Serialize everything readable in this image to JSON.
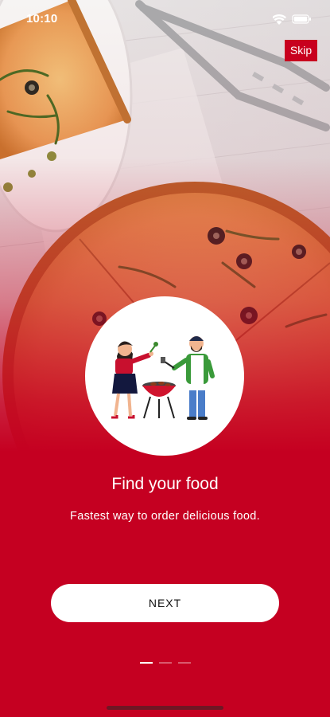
{
  "status_bar": {
    "time": "10:10",
    "icons": [
      "wifi-icon",
      "battery-icon"
    ]
  },
  "skip_label": "Skip",
  "onboarding": {
    "title": "Find your food",
    "subtitle": "Fastest way to order delicious food.",
    "illustration": "couple-barbecue-illustration"
  },
  "next_label": "NEXT",
  "pager": {
    "total_pages": 3,
    "current_page": 1
  },
  "colors": {
    "brand_red": "#c8001e",
    "background_red": "#c50021",
    "button_bg": "#ffffff"
  }
}
